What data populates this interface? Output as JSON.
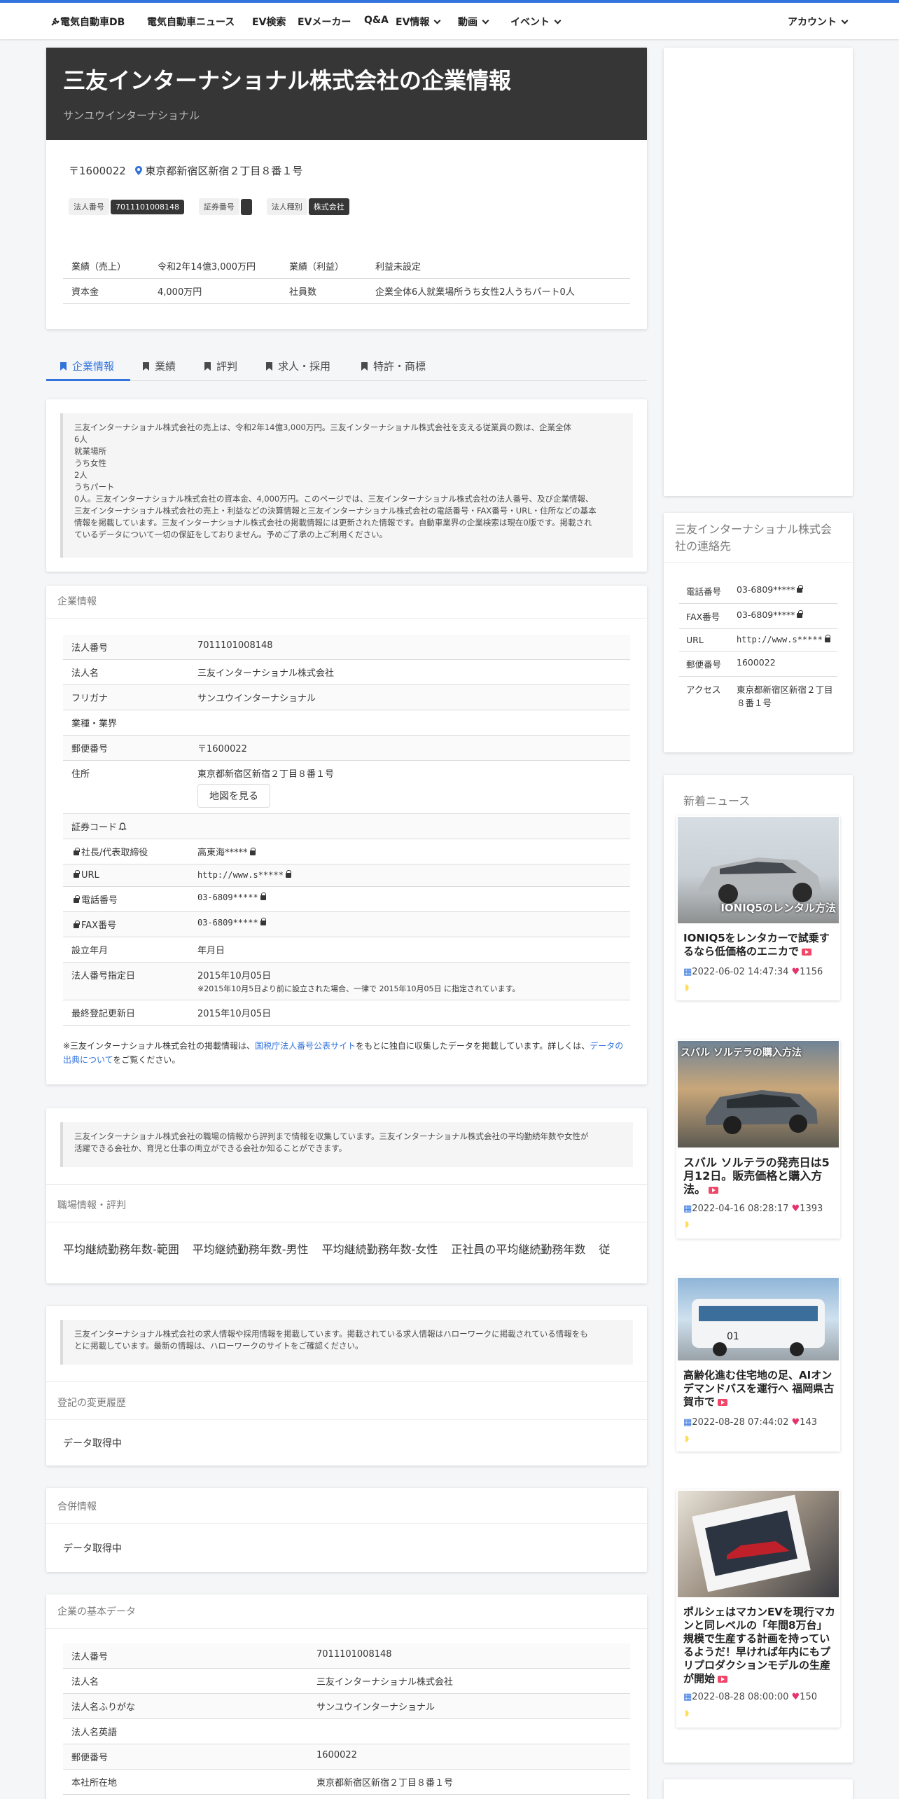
{
  "nav": {
    "logo": "電気自動車DB",
    "items": [
      "電気自動車ニュース",
      "EV検索",
      "EVメーカー",
      "Q&A",
      "EV情報",
      "動画",
      "イベント"
    ],
    "account": "アカウント"
  },
  "company": {
    "title": "三友インターナショナル株式会社の企業情報",
    "kana": "サンユウインターナショナル",
    "postal": "〒1600022",
    "address": "東京都新宿区新宿２丁目８番１号",
    "tags": {
      "corp_no_label": "法人番号",
      "corp_no": "7011101008148",
      "sec_label": "証券番号",
      "sec_value": "",
      "type_label": "法人種別",
      "type_value": "株式会社"
    },
    "summary": {
      "sales_label": "業績（売上）",
      "sales": "令和2年14億3,000万円",
      "profit_label": "業績（利益）",
      "profit": "利益未設定",
      "capital_label": "資本金",
      "capital": "4,000万円",
      "emp_label": "社員数",
      "emp": "企業全体6人就業場所うち女性2人うちパート0人"
    }
  },
  "tabs": [
    "企業情報",
    "業績",
    "評判",
    "求人・採用",
    "特許・商標"
  ],
  "intro_text": "三友インターナショナル株式会社の売上は、令和2年14億3,000万円。三友インターナショナル株式会社を支える従業員の数は、企業全体\n6人\n就業場所\nうち女性\n2人\nうちパート\n0人。三友インターナショナル株式会社の資本金、4,000万円。このページでは、三友インターナショナル株式会社の法人番号、及び企業情報、\n三友インターナショナル株式会社の売上・利益などの決算情報と三友インターナショナル株式会社の電話番号・FAX番号・URL・住所などの基本\n情報を掲載しています。三友インターナショナル株式会社の掲載情報には更新された情報です。自動車業界の企業検索は現在0版です。掲載され\nているデータについて一切の保証をしておりません。予めご了承の上ご利用ください。",
  "info": {
    "heading": "企業情報",
    "rows": [
      {
        "k": "法人番号",
        "v": "7011101008148"
      },
      {
        "k": "法人名",
        "v": "三友インターナショナル株式会社"
      },
      {
        "k": "フリガナ",
        "v": "サンユウインターナショナル"
      },
      {
        "k": "業種・業界",
        "v": ""
      },
      {
        "k": "郵便番号",
        "v": "〒1600022"
      },
      {
        "k": "住所",
        "v": "東京都新宿区新宿２丁目８番１号",
        "btn": "地図を見る"
      },
      {
        "k": "証券コード",
        "v": ""
      },
      {
        "k": "社長/代表取締役",
        "v": "高東海*****"
      },
      {
        "k": "URL",
        "v": "http://www.s*****"
      },
      {
        "k": "電話番号",
        "v": "03-6809*****"
      },
      {
        "k": "FAX番号",
        "v": "03-6809*****"
      },
      {
        "k": "設立年月",
        "v": "年月日"
      },
      {
        "k": "法人番号指定日",
        "v": "2015年10月05日",
        "sub": "※2015年10月5日より前に設立された場合、一律で 2015年10月05日 に指定されています。"
      },
      {
        "k": "最終登記更新日",
        "v": "2015年10月05日"
      }
    ],
    "note_pre": "※三友インターナショナル株式会社の掲載情報は、",
    "note_link1": "国税庁法人番号公表サイト",
    "note_mid": "をもとに独自に収集したデータを掲載しています。詳しくは、",
    "note_link2": "データの出典について",
    "note_post": "をご覧ください。"
  },
  "workplace": {
    "quote": "三友インターナショナル株式会社の職場の情報から評判まで情報を収集しています。三友インターナショナル株式会社の平均勤続年数や女性が\n活躍できる会社か、育児と仕事の両立ができる会社か知ることができます。",
    "heading": "職場情報・評判",
    "cols": [
      "平均継続勤務年数-範囲",
      "平均継続勤務年数-男性",
      "平均継続勤務年数-女性",
      "正社員の平均継続勤務年数",
      "従"
    ]
  },
  "recruit": {
    "quote": "三友インターナショナル株式会社の求人情報や採用情報を掲載しています。掲載されている求人情報はハローワークに掲載されている情報をも\nとに掲載しています。最新の情報は、ハローワークのサイトをご確認ください。"
  },
  "history": {
    "heading": "登記の変更履歴",
    "text": "データ取得中"
  },
  "merger": {
    "heading": "合併情報",
    "text": "データ取得中"
  },
  "basic": {
    "heading": "企業の基本データ",
    "rows": [
      {
        "k": "法人番号",
        "v": "7011101008148"
      },
      {
        "k": "法人名",
        "v": "三友インターナショナル株式会社"
      },
      {
        "k": "法人名ふりがな",
        "v": "サンユウインターナショナル"
      },
      {
        "k": "法人名英語",
        "v": ""
      },
      {
        "k": "郵便番号",
        "v": "1600022"
      },
      {
        "k": "本社所在地",
        "v": "東京都新宿区新宿２丁目８番１号"
      }
    ]
  },
  "contact": {
    "title": "三友インターナショナル株式会社の連絡先",
    "rows": [
      {
        "k": "電話番号",
        "v": "03-6809*****"
      },
      {
        "k": "FAX番号",
        "v": "03-6809*****"
      },
      {
        "k": "URL",
        "v": "http://www.s*****"
      },
      {
        "k": "郵便番号",
        "v": "1600022"
      },
      {
        "k": "アクセス",
        "v": "東京都新宿区新宿２丁目８番１号"
      }
    ]
  },
  "news": {
    "title": "新着ニュース",
    "items": [
      {
        "overlay": "IONIQ5のレンタル方法",
        "title": "IONIQ5をレンタカーで試乗するなら低価格のエニカで",
        "date": "2022-06-02 14:47:34",
        "likes": "1156"
      },
      {
        "overlay": "スバル ソルテラの購入方法",
        "title": "スバル ソルテラの発売日は5月12日。販売価格と購入方法。",
        "date": "2022-04-16 08:28:17",
        "likes": "1393"
      },
      {
        "overlay": "",
        "title": "高齢化進む住宅地の足、AIオンデマンドバスを運行へ 福岡県古賀市で",
        "date": "2022-08-28 07:44:02",
        "likes": "143"
      },
      {
        "overlay": "",
        "title": "ポルシェはマカンEVを現行マカンと同レベルの「年間8万台」規模で生産する計画を持っているようだ！早ければ年内にもプリプロダクションモデルの生産が開始",
        "date": "2022-08-28 08:00:00",
        "likes": "150"
      }
    ]
  },
  "colors": {
    "accent": "#3273dc",
    "hero_bg": "#363636",
    "heart": "#e5336b",
    "youtube": "#f14668"
  }
}
